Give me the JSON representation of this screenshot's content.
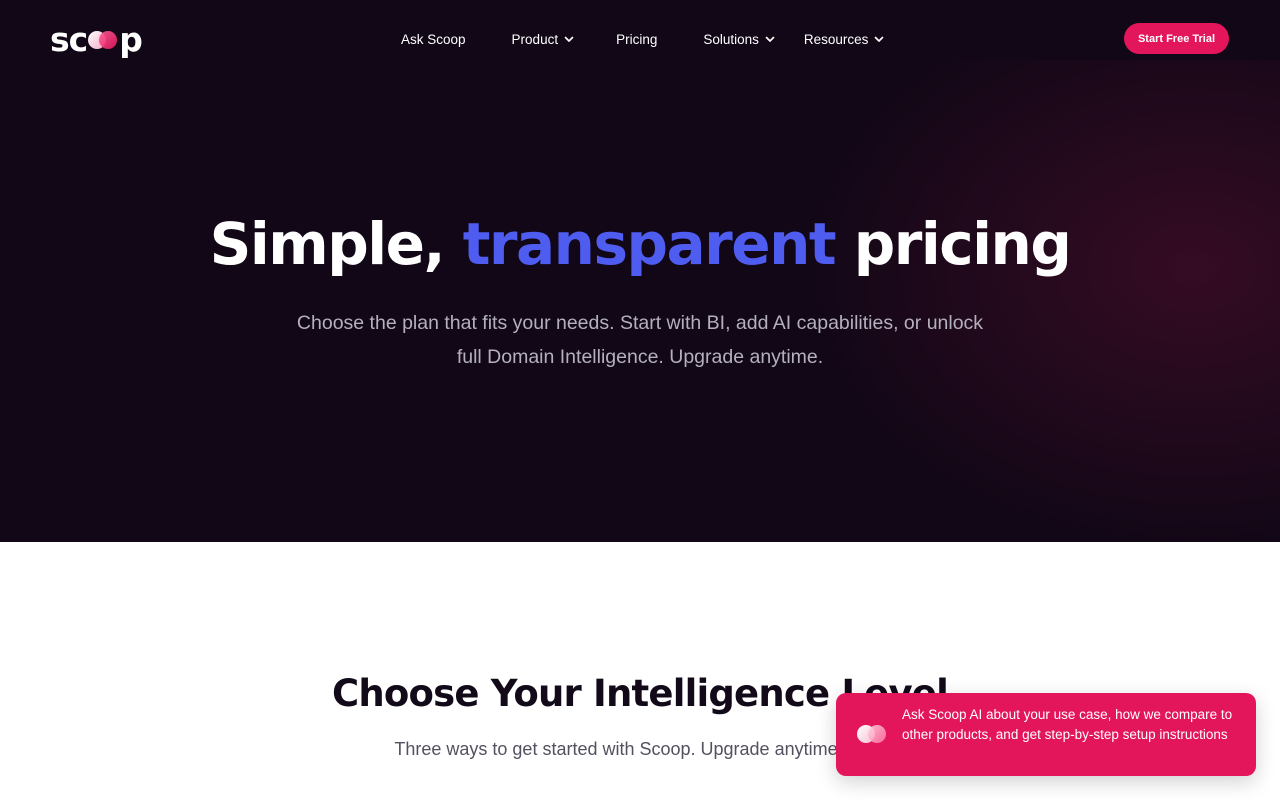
{
  "header": {
    "logo_text": "scoop",
    "nav": [
      {
        "label": "Ask Scoop",
        "dropdown": false
      },
      {
        "label": "Product",
        "dropdown": true
      },
      {
        "label": "Pricing",
        "dropdown": false
      },
      {
        "label": "Solutions",
        "dropdown": true
      },
      {
        "label": "Resources",
        "dropdown": true
      }
    ],
    "cta_label": "Start Free Trial"
  },
  "hero": {
    "title_start": "Simple, ",
    "title_accent": "transparent",
    "title_end": " pricing",
    "subtitle": "Choose the plan that fits your needs. Start with BI, add AI capabilities, or unlock full Domain Intelligence. Upgrade anytime."
  },
  "section": {
    "title": "Choose Your Intelligence Level",
    "subtitle": "Three ways to get started with Scoop. Upgrade anytime as yo"
  },
  "chat_popup": {
    "text": "Ask Scoop AI about your use case, how we compare to other products, and get step-by-step setup instructions",
    "icon": "scoop-rings-icon"
  },
  "colors": {
    "hero_bg": "#110716",
    "accent_blue": "#4f5cf0",
    "brand_pink": "#e3165b",
    "text_dark": "#120a18"
  }
}
